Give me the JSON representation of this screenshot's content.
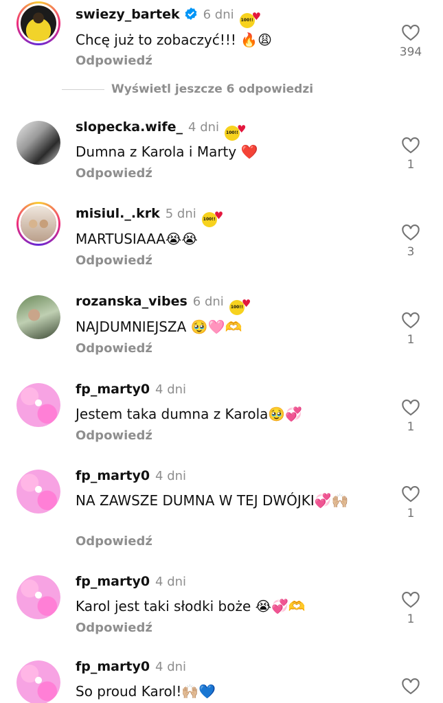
{
  "comments": [
    {
      "username": "swiezy_bartek",
      "time": "6 dni",
      "text": "Chcę już to zobaczyć!!! 🔥😩",
      "reply": "Odpowiedź",
      "likes": "394",
      "verified": true,
      "badge": "100!!"
    },
    {
      "username": "slopecka.wife_",
      "time": "4 dni",
      "text": "Dumna z Karola i Marty ❤️",
      "reply": "Odpowiedź",
      "likes": "1",
      "badge": "100!!"
    },
    {
      "username": "misiul._.krk",
      "time": "5 dni",
      "text": "MARTUSIAAA😭😭",
      "reply": "Odpowiedź",
      "likes": "3",
      "badge": "100!!"
    },
    {
      "username": "rozanska_vibes",
      "time": "6 dni",
      "text": "NAJDUMNIEJSZA 🥹🩷🫶",
      "reply": "Odpowiedź",
      "likes": "1",
      "badge": "100!!"
    },
    {
      "username": "fp_marty0",
      "time": "4 dni",
      "text": "Jestem taka dumna z Karola🥹💞",
      "reply": "Odpowiedź",
      "likes": "1"
    },
    {
      "username": "fp_marty0",
      "time": "4 dni",
      "text": "NA ZAWSZE DUMNA W TEJ DWÓJKI💞🙌🏼",
      "reply": "Odpowiedź",
      "likes": "1"
    },
    {
      "username": "fp_marty0",
      "time": "4 dni",
      "text": "Karol jest taki słodki boże 😭💞🫶",
      "reply": "Odpowiedź",
      "likes": "1"
    },
    {
      "username": "fp_marty0",
      "time": "4 dni",
      "text": "So proud Karol!🙌🏼💙",
      "reply": "",
      "likes": ""
    }
  ],
  "view_more_label": "Wyświetl jeszcze 6 odpowiedzi",
  "icons": {
    "like": "heart-outline-icon",
    "verified": "verified-badge-icon",
    "badge": "100-badge-icon"
  },
  "colors": {
    "muted": "#8e8e8e",
    "verified": "#0095f6",
    "badge": "#f7d21e",
    "heart": "#e3173e"
  }
}
